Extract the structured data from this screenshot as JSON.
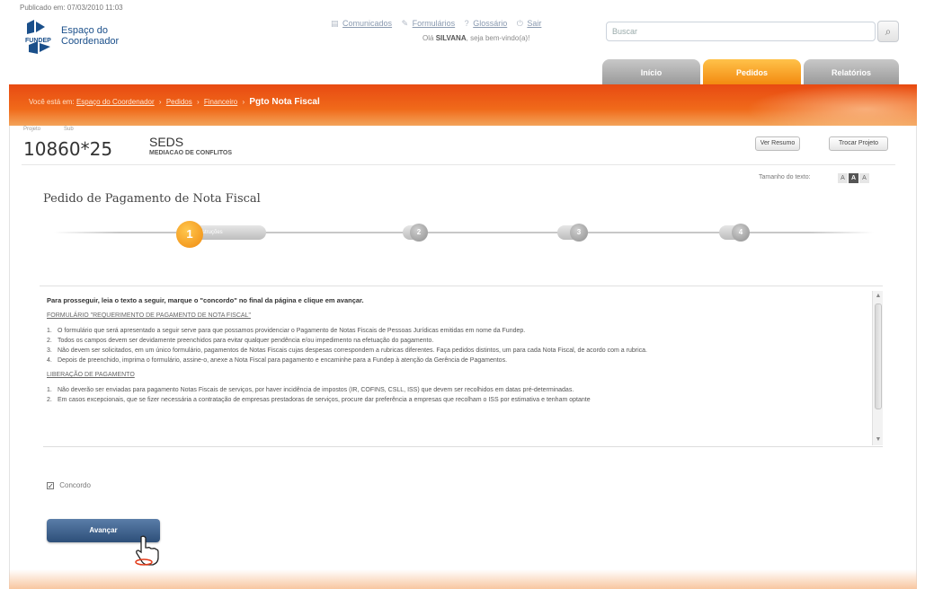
{
  "meta": {
    "published": "Publicado em: 07/03/2010 11:03"
  },
  "logo": {
    "line1": "Espaço do",
    "line2": "Coordenador",
    "mark_text": "FUNDEP"
  },
  "top_links": {
    "items": [
      "Comunicados",
      "Formulários",
      "Glossário",
      "Sair"
    ]
  },
  "greeting": {
    "prefix": "Olá",
    "name": "SILVANA",
    "suffix": ", seja bem-vindo(a)!"
  },
  "search": {
    "placeholder": "Buscar"
  },
  "main_tabs": [
    "Início",
    "Pedidos",
    "Relatórios"
  ],
  "breadcrumb": {
    "prefix": "Você está em:",
    "items": [
      "Espaço do Coordenador",
      "Pedidos",
      "Financeiro"
    ],
    "current": "Pgto Nota Fiscal"
  },
  "project": {
    "label_project": "Projeto",
    "label_sub": "Sub",
    "number": "10860*25",
    "org": "SEDS",
    "description": "MEDIACAO DE CONFLITOS"
  },
  "buttons": {
    "ver_saldo": "Ver Resumo",
    "trocar_projeto": "Trocar Projeto",
    "advance": "Avançar"
  },
  "text_size": {
    "label": "Tamanho do texto:",
    "minus": "A",
    "mid": "A",
    "plus": "A"
  },
  "page_title": "Pedido de Pagamento de Nota Fiscal",
  "steps": [
    {
      "number": "1",
      "label": "Instruções"
    },
    {
      "number": "2",
      "label": ""
    },
    {
      "number": "3",
      "label": ""
    },
    {
      "number": "4",
      "label": ""
    }
  ],
  "instructions": {
    "intro": "Para prosseguir, leia o texto a seguir, marque o \"concordo\" no final da página e clique em avançar.",
    "section1": "FORMULÁRIO \"REQUERIMENTO DE PAGAMENTO DE NOTA FISCAL\"",
    "items1": [
      "O formulário que será apresentado a seguir serve para que possamos providenciar o Pagamento de Notas Fiscais de Pessoas Jurídicas emitidas em nome da Fundep.",
      "Todos os campos devem ser devidamente preenchidos para evitar qualquer pendência e/ou impedimento na efetuação do pagamento.",
      "Não devem ser solicitados, em um único formulário, pagamentos de Notas Fiscais cujas despesas correspondem a rubricas diferentes. Faça pedidos distintos, um para cada Nota Fiscal, de acordo com a rubrica.",
      "Depois de preenchido, imprima o formulário, assine-o, anexe a Nota Fiscal para pagamento e encaminhe para a Fundep à atenção da Gerência de Pagamentos."
    ],
    "section2": "LIBERAÇÃO DE PAGAMENTO",
    "items2": [
      "Não deverão ser enviadas para pagamento Notas Fiscais de serviços, por haver incidência de impostos (IR, COFINS, CSLL, ISS) que devem ser recolhidos em datas pré-determinadas.",
      "Em casos excepcionais, que se fizer necessária a contratação de empresas prestadoras de serviços, procure dar preferência a empresas que recolham o ISS por estimativa e tenham optante"
    ]
  },
  "agree_label": "Concordo",
  "colors": {
    "brand_orange": "#f06a1a",
    "brand_blue": "#2d4f79"
  }
}
